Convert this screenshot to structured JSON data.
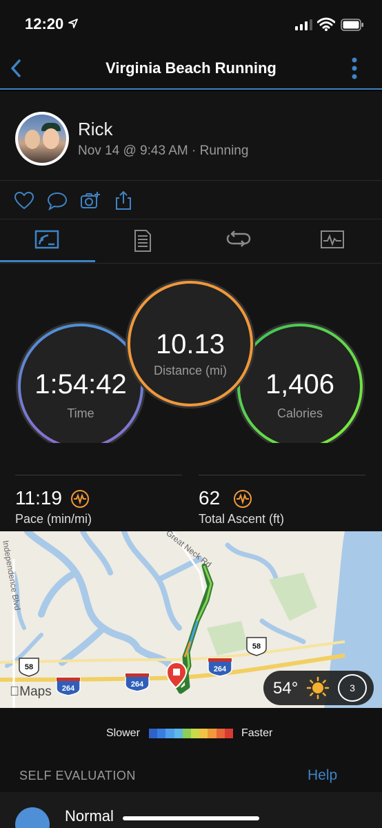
{
  "status_bar": {
    "time": "12:20",
    "icons": [
      "location-arrow-icon",
      "signal-icon",
      "wifi-icon",
      "battery-icon"
    ]
  },
  "nav": {
    "title": "Virginia Beach Running",
    "back_icon": "chevron-left-icon",
    "more_icon": "more-vertical-icon"
  },
  "profile": {
    "name": "Rick",
    "subtitle": "Nov 14 @ 9:43 AM · Running"
  },
  "actions": [
    "heart-icon",
    "comment-icon",
    "camera-add-icon",
    "share-icon"
  ],
  "tabs": [
    {
      "icon": "overview-icon",
      "active": true
    },
    {
      "icon": "details-icon",
      "active": false
    },
    {
      "icon": "laps-icon",
      "active": false
    },
    {
      "icon": "charts-icon",
      "active": false
    }
  ],
  "circles": {
    "time": {
      "value": "1:54:42",
      "label": "Time"
    },
    "distance": {
      "value": "10.13",
      "label": "Distance (mi)"
    },
    "calories": {
      "value": "1,406",
      "label": "Calories"
    }
  },
  "stats": {
    "pace": {
      "value": "11:19",
      "label": "Pace (min/mi)",
      "icon": "activity-wave-icon"
    },
    "ascent": {
      "value": "62",
      "label": "Total Ascent (ft)",
      "icon": "activity-wave-icon"
    }
  },
  "map": {
    "labels": {
      "road_neck": "Great Neck Rd",
      "road_independence": "Independence Blvd",
      "route_58_a": "58",
      "route_58_b": "58",
      "interstate_264_a": "264",
      "interstate_264_b": "264",
      "interstate_264_c": "264"
    },
    "maps_label": "Maps",
    "weather": {
      "temp": "54°",
      "icon": "sun-icon",
      "wind": "3"
    }
  },
  "legend": {
    "slow_label": "Slower",
    "fast_label": "Faster",
    "colors": [
      "#2f62c9",
      "#3a7de0",
      "#4ea0ea",
      "#5fb8e6",
      "#8ccf54",
      "#c8d94a",
      "#f0c344",
      "#f09a3a",
      "#e8663a",
      "#d83b32"
    ]
  },
  "self_evaluation": {
    "title": "SELF EVALUATION",
    "help": "Help",
    "feel": "Normal"
  },
  "colors": {
    "accent": "#3f84c6",
    "time_ring_start": "#4f8fd6",
    "time_ring_end": "#8b6fd0",
    "distance_ring": "#f0983a",
    "calories_ring_start": "#3fbf5a",
    "calories_ring_end": "#7ef03a"
  }
}
